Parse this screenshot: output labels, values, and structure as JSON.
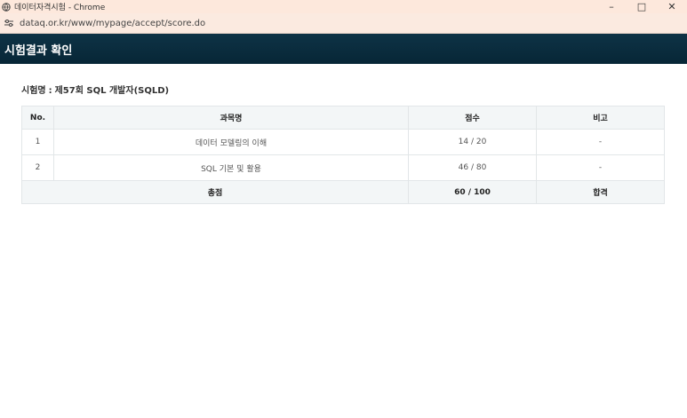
{
  "window": {
    "title": "데이터자격시험 - Chrome",
    "url": "dataq.or.kr/www/mypage/accept/score.do"
  },
  "page": {
    "title": "시험결과 확인"
  },
  "exam": {
    "label": "시험명",
    "separator": ":",
    "name": "제57회 SQL 개발자(SQLD)"
  },
  "table": {
    "headers": [
      "No.",
      "과목명",
      "점수",
      "비고"
    ],
    "rows": [
      {
        "no": "1",
        "subject": "데이터 모델링의 이해",
        "score": "14 / 20",
        "note": "-"
      },
      {
        "no": "2",
        "subject": "SQL 기본 및 활용",
        "score": "46 / 80",
        "note": "-"
      }
    ],
    "total": {
      "label": "총점",
      "score": "60 / 100",
      "result": "합격"
    }
  },
  "icons": {
    "favicon": "globe-icon",
    "site_info": "tune-icon",
    "minimize": "minimize-icon",
    "maximize": "maximize-icon",
    "close": "close-icon"
  },
  "colors": {
    "header_bg": "#0b2f41",
    "titlebar_bg": "#fde8dc",
    "table_header_bg": "#f3f6f7"
  }
}
